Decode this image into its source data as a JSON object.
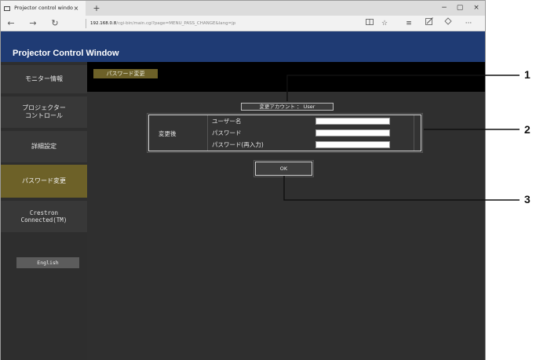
{
  "browser": {
    "tab_title": "Projector control windo",
    "tab_close": "×",
    "new_tab": "+",
    "minimize": "−",
    "maximize": "▢",
    "close": "×",
    "back": "←",
    "forward": "→",
    "refresh": "↻",
    "url_host": "192.168.0.8",
    "url_path": "/cgi-bin/main.cgi?page=MENU_PASS_CHANGE&lang=jp",
    "reading_view_icon": "book-icon",
    "favorite_icon": "star-icon",
    "hub_icon": "hub-icon",
    "note_icon": "pen-icon",
    "share_icon": "share-icon",
    "more_label": "···"
  },
  "app": {
    "title": "Projector Control Window"
  },
  "sidebar": {
    "items": [
      {
        "label": "モニター情報"
      },
      {
        "label_line1": "プロジェクター",
        "label_line2": "コントロール"
      },
      {
        "label": "詳細設定"
      },
      {
        "label": "パスワード変更"
      },
      {
        "label_line1": "Crestron",
        "label_line2": "Connected(TM)"
      }
    ],
    "english_button": "English"
  },
  "main": {
    "tab_label": "パスワード変更",
    "account_label": "変更アカウント ： User",
    "after_label": "変更後",
    "fields": {
      "username": "ユーザー名",
      "password": "パスワード",
      "password_confirm": "パスワード(再入力)"
    },
    "ok_button": "OK"
  },
  "callouts": [
    "1",
    "2",
    "3"
  ],
  "colors": {
    "header_blue": "#1f3b74",
    "active_gold": "#6d6128",
    "panel_dark": "#2f2f2f"
  }
}
